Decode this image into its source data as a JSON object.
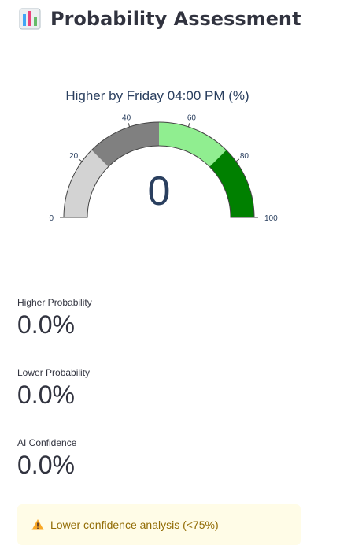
{
  "header": {
    "icon": "bar-chart-icon",
    "title": "Probability Assessment"
  },
  "gauge": {
    "title": "Higher by Friday 04:00 PM (%)",
    "value": 0,
    "value_text": "0",
    "range": [
      0,
      100
    ],
    "tick_labels": [
      "0",
      "20",
      "40",
      "60",
      "80",
      "100"
    ],
    "steps": [
      {
        "from": 0,
        "to": 25,
        "color": "#d3d3d3"
      },
      {
        "from": 25,
        "to": 50,
        "color": "#808080"
      },
      {
        "from": 50,
        "to": 75,
        "color": "#90ee90"
      },
      {
        "from": 75,
        "to": 100,
        "color": "#008000"
      }
    ]
  },
  "metrics": {
    "higher": {
      "label": "Higher Probability",
      "value": "0.0%"
    },
    "lower": {
      "label": "Lower Probability",
      "value": "0.0%"
    },
    "confidence": {
      "label": "AI Confidence",
      "value": "0.0%"
    }
  },
  "alert": {
    "icon": "warning-icon",
    "text": "Lower confidence analysis (<75%)",
    "background": "#fffce7",
    "text_color": "#926c05"
  }
}
